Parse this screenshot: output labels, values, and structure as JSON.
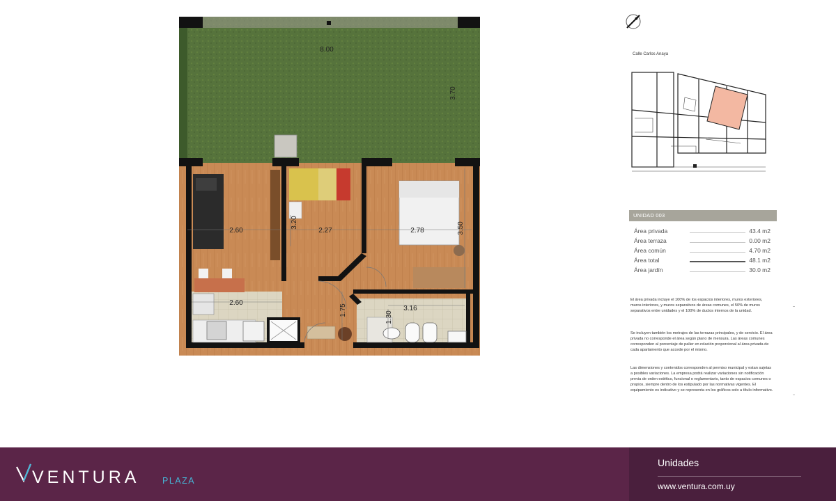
{
  "plan": {
    "dims": {
      "garden_width": "8.00",
      "garden_depth": "3.70",
      "living_width": "2.60",
      "wall_320": "3.20",
      "room2_width": "2.27",
      "room1_width": "2.78",
      "room1_depth": "3.50",
      "kitchen_width": "2.60",
      "hall": "1.75",
      "bath_depth": "1.30",
      "bath_width": "3.16"
    },
    "colors": {
      "grass": "#56733c",
      "floor": "#c98a55",
      "wall": "#121212",
      "tile": "#dcd6c2"
    }
  },
  "site": {
    "street": "Calle Carlos Anaya",
    "highlight_color": "#f3b8a2"
  },
  "unit": {
    "header": "UNIDAD 003",
    "areas": [
      {
        "label": "Área privada",
        "value": "43.4 m2"
      },
      {
        "label": "Área terraza",
        "value": "0.00 m2"
      },
      {
        "label": "Área común",
        "value": "4.70 m2"
      },
      {
        "label": "Área total",
        "value": "48.1 m2"
      },
      {
        "label": "Área jardín",
        "value": "30.0 m2"
      }
    ]
  },
  "notes": [
    "El área privada incluye el 100% de los espacios interiores, muros exteriores, muros interiores, y muros separativos de áreas comunes, el 50% de muros separativos entre unidades y el 100% de ductos internos de la unidad.",
    "Se incluyen también los metrajes de las terrazas principales, y de servicio. El área privada no corresponde el área según plano de mensura. Las áreas comunes corresponden al porcentaje de palier en relación proporcional al área privada de cada apartamento que accede por el mismo.",
    "Las dimensiones y contenidos corresponden al permiso municipal y estan sujetas a posibles variaciones. La empresa podrá realizar variaciones sin notificación previa de orden estético, funcional o reglamentario, tanto de espacios comunes o propios, siempre dentro de los estipulado por las normativas vigentes. El equipamiento es indicativo y se representa en los gráficos solo a título informativo."
  ],
  "footer": {
    "brand": "VENTURA",
    "brand_sub": "PLAZA",
    "section": "Unidades",
    "url": "www.ventura.com.uy",
    "brand_color": "#5b2548",
    "accent_color": "#46b5d6"
  }
}
